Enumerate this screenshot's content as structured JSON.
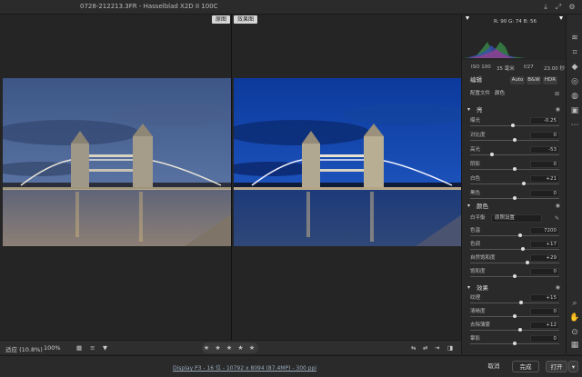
{
  "title": "0728-212213.3FR - Hasselblad X2D II 100C",
  "labels": {
    "before": "原图",
    "after": "效果图"
  },
  "hist": {
    "rgb": "R: 90   G: 74   B: 56"
  },
  "exif": {
    "iso": "ISO 100",
    "focal": "35 毫米",
    "ap": "f/27",
    "time": "23.00 秒"
  },
  "edit": {
    "title": "编辑",
    "auto": "Auto",
    "bw": "B&W",
    "hdr": "HDR",
    "profile_label": "配置文件",
    "profile_value": "颜色"
  },
  "light": {
    "title": "亮",
    "rows": [
      {
        "name": "曝光",
        "value": "-0.25",
        "pos": 0.48
      },
      {
        "name": "对比度",
        "value": "0",
        "pos": 0.5
      },
      {
        "name": "高光",
        "value": "-53",
        "pos": 0.24
      },
      {
        "name": "阴影",
        "value": "0",
        "pos": 0.5
      },
      {
        "name": "白色",
        "value": "+21",
        "pos": 0.6
      },
      {
        "name": "黑色",
        "value": "0",
        "pos": 0.5
      }
    ]
  },
  "color": {
    "title": "颜色",
    "wb_label": "白平衡",
    "wb_value": "原照设置",
    "rows": [
      {
        "name": "色温",
        "value": "7200",
        "pos": 0.56
      },
      {
        "name": "色调",
        "value": "+17",
        "pos": 0.59
      },
      {
        "name": "自然饱和度",
        "value": "+29",
        "pos": 0.64
      },
      {
        "name": "饱和度",
        "value": "0",
        "pos": 0.5
      }
    ]
  },
  "effects": {
    "title": "效果",
    "rows": [
      {
        "name": "纹理",
        "value": "+15",
        "pos": 0.57
      },
      {
        "name": "清晰度",
        "value": "0",
        "pos": 0.5
      },
      {
        "name": "去除薄雾",
        "value": "+12",
        "pos": 0.56
      },
      {
        "name": "暈影",
        "value": "0",
        "pos": 0.5
      }
    ]
  },
  "bottom": {
    "zoom": "适应 (10.8%)",
    "zoom100": "100%",
    "stars": "★ ★ ★ ★ ★"
  },
  "status": {
    "link": "Display P3 - 16 位 - 10792 x 8094 (87.4MP) - 300 ppi",
    "cancel": "取消",
    "done": "完成",
    "open": "打开"
  },
  "colors": {
    "accent": "#3b8ee8",
    "panel": "#2a2a2a"
  }
}
